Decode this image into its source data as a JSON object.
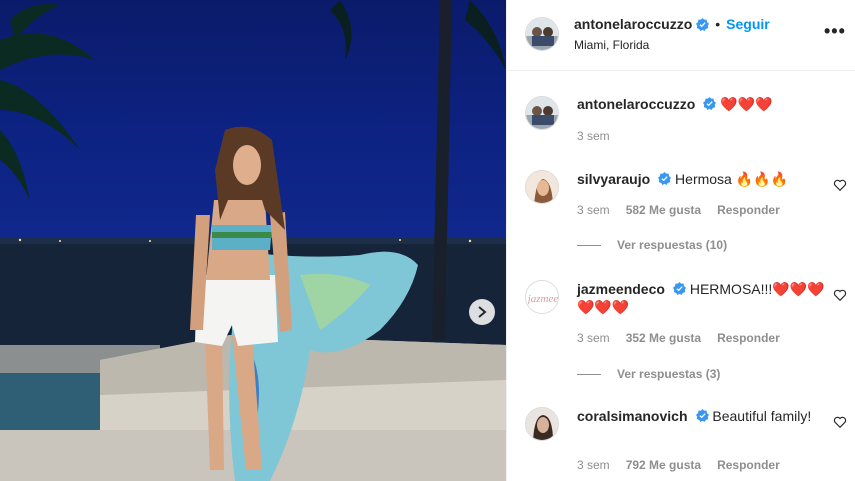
{
  "post": {
    "username": "antonelaroccuzzo",
    "follow_label": "Seguir",
    "separator": "•",
    "location": "Miami, Florida",
    "more_label": "•••"
  },
  "caption": {
    "username": "antonelaroccuzzo",
    "text": "❤️❤️❤️",
    "time": "3 sem"
  },
  "comments": [
    {
      "username": "silvyaraujo",
      "text": "Hermosa 🔥🔥🔥",
      "time": "3 sem",
      "likes": "582 Me gusta",
      "reply_label": "Responder",
      "view_replies": "Ver respuestas (10)"
    },
    {
      "username": "jazmeendeco",
      "text": "HERMOSA!!!❤️❤️❤️❤️❤️❤️",
      "time": "3 sem",
      "likes": "352 Me gusta",
      "reply_label": "Responder",
      "view_replies": "Ver respuestas (3)"
    },
    {
      "username": "coralsimanovich",
      "text": "Beautiful family!",
      "time": "3 sem",
      "likes": "792 Me gusta",
      "reply_label": "Responder"
    }
  ],
  "colors": {
    "accent": "#0095f6",
    "verified": "#3897f0",
    "muted": "#8e8e8e",
    "text": "#262626"
  },
  "icons": {
    "verified": "verified-badge-icon",
    "heart": "heart-outline-icon",
    "next": "chevron-right-icon",
    "more": "more-options-icon"
  }
}
